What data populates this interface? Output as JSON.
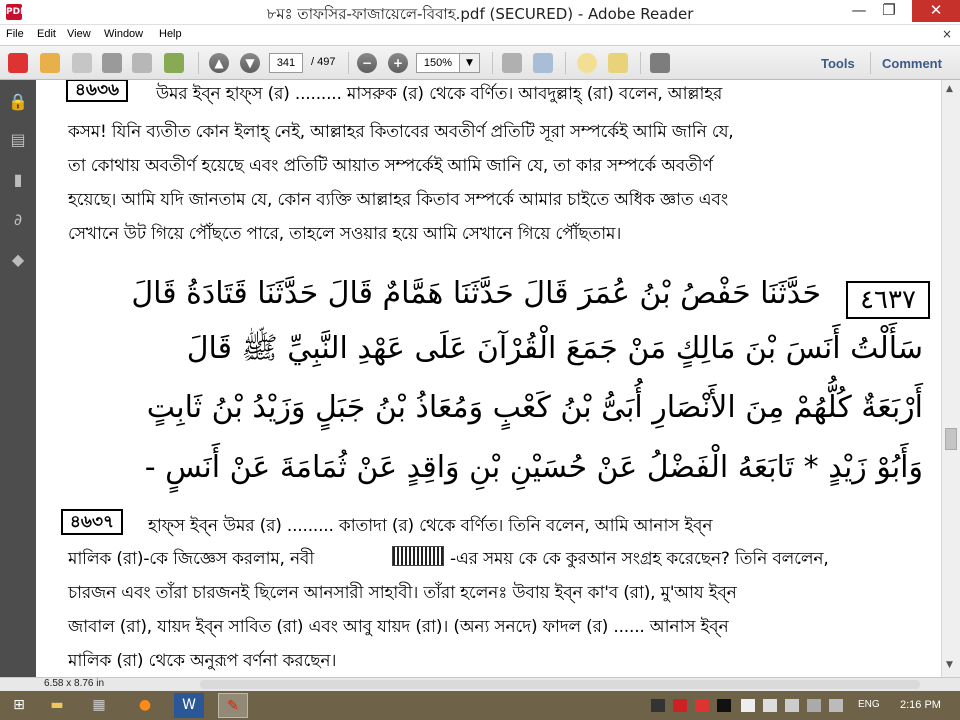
{
  "window": {
    "title": "৮মঃ তাফসির-ফাজায়েলে-বিবাহ.pdf (SECURED) - Adobe Reader",
    "app_icon_label": "PDF",
    "minimize_glyph": "—",
    "maximize_glyph": "❐",
    "close_glyph": "✕"
  },
  "menu": {
    "items": [
      "File",
      "Edit",
      "View",
      "Window",
      "Help"
    ],
    "close_doc_glyph": "×"
  },
  "toolbar": {
    "current_page": "341",
    "total_pages": "/ 497",
    "zoom": "150%",
    "zoom_drop_glyph": "▼",
    "prev_glyph": "▲",
    "next_glyph": "▼",
    "zoom_out_glyph": "−",
    "zoom_in_glyph": "+",
    "tools_label": "Tools",
    "comment_label": "Comment"
  },
  "document": {
    "h1_number": "৪৬৩৬",
    "bn1": [
      "উমর ইব্‌ন হাফ্‌স (র) ......... মাসরুক (র) থেকে বর্ণিত। আবদুল্লাহ্‌ (রা) বলেন, আল্লাহর",
      "কসম! যিনি ব্যতীত কোন ইলাহ্‌ নেই, আল্লাহর কিতাবের অবতীর্ণ প্রতিটি সূরা সম্পর্কেই আমি জানি যে,",
      "তা কোথায় অবতীর্ণ হয়েছে এবং প্রতিটি আয়াত সম্পর্কেই আমি জানি যে, তা কার সম্পর্কে অবতীর্ণ",
      "হয়েছে। আমি যদি জানতাম যে, কোন ব্যক্তি আল্লাহর কিতাব সম্পর্কে আমার চাইতে অধিক জ্ঞাত এবং",
      "সেখানে উট গিয়ে পৌঁছতে পারে, তাহলে সওয়ার হয়ে আমি সেখানে গিয়ে পৌঁছতাম।"
    ],
    "ar_number": "٤٦٣٧",
    "arabic": [
      "حَدَّثَنَا حَفْصُ بْنُ عُمَرَ قَالَ حَدَّثَنَا هَمَّامٌ قَالَ حَدَّثَنَا قَتَادَةُ قَالَ",
      "سَأَلْتُ أَنَسَ بْنَ مَالِكٍ مَنْ جَمَعَ الْقُرْآنَ عَلَى عَهْدِ النَّبِيِّ ﷺ قَالَ",
      "أَرْبَعَةٌ كُلُّهُمْ مِنَ الأَنْصَارِ أُبَىُّ بْنُ كَعْبٍ وَمُعَاذُ بْنُ جَبَلٍ وَزَيْدُ بْنُ ثَابِتٍ",
      "وَأَبُوْ زَيْدٍ * تَابَعَهُ الْفَضْلُ عَنْ حُسَيْنِ بْنِ وَاقِدٍ عَنْ ثُمَامَةَ عَنْ أَنَسٍ -"
    ],
    "h2_number": "৪৬৩৭",
    "bn2_line1": "হাফ্‌স ইব্‌ন উমর (র) ......... কাতাদা (র) থেকে বর্ণিত। তিনি বলেন, আমি আনাস ইব্‌ন",
    "bn2_line2a": "মালিক (রা)-কে জিজ্ঞেস করলাম, নবী",
    "bn2_line2b": "-এর সময় কে কে কুরআন সংগ্রহ করেছেন? তিনি বললেন,",
    "bn2_rest": [
      "চারজন এবং তাঁরা চারজনই ছিলেন আনসারী সাহাবী। তাঁরা হলেনঃ উবায় ইব্‌ন কা'ব (রা), মু'আয ইব্‌ন",
      "জাবাল (রা), যায়দ ইব্‌ন সাবিত (রা) এবং আবু যায়দ (রা)। (অন্য সনদে) ফাদল (র) ...... আনাস ইব্‌ন",
      "মালিক (রা) থেকে অনুরূপ বর্ণনা করছেন।"
    ]
  },
  "status": {
    "page_size": "6.58 x 8.76 in"
  },
  "taskbar": {
    "lang": "ENG",
    "time": "2:16 PM"
  }
}
